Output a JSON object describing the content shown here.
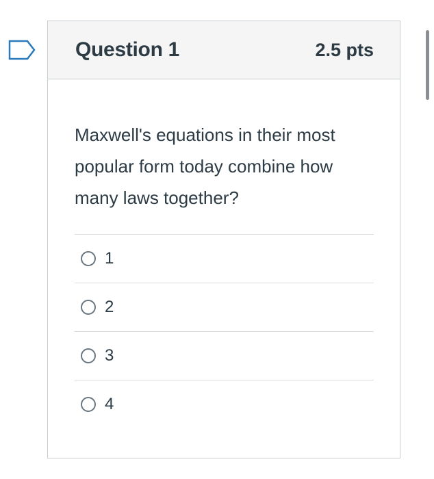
{
  "question": {
    "title": "Question 1",
    "points": "2.5 pts",
    "text": "Maxwell's equations in their most popular form today combine how many laws together?",
    "answers": [
      {
        "label": "1",
        "selected": false
      },
      {
        "label": "2",
        "selected": false
      },
      {
        "label": "3",
        "selected": false
      },
      {
        "label": "4",
        "selected": false
      }
    ]
  },
  "icons": {
    "flag": "flag-question-icon",
    "radio": "radio-button-icon"
  },
  "colors": {
    "flag_outline": "#2b7abc",
    "header_bg": "#f5f5f5",
    "border": "#c7cdd1",
    "text": "#2d3b45"
  }
}
